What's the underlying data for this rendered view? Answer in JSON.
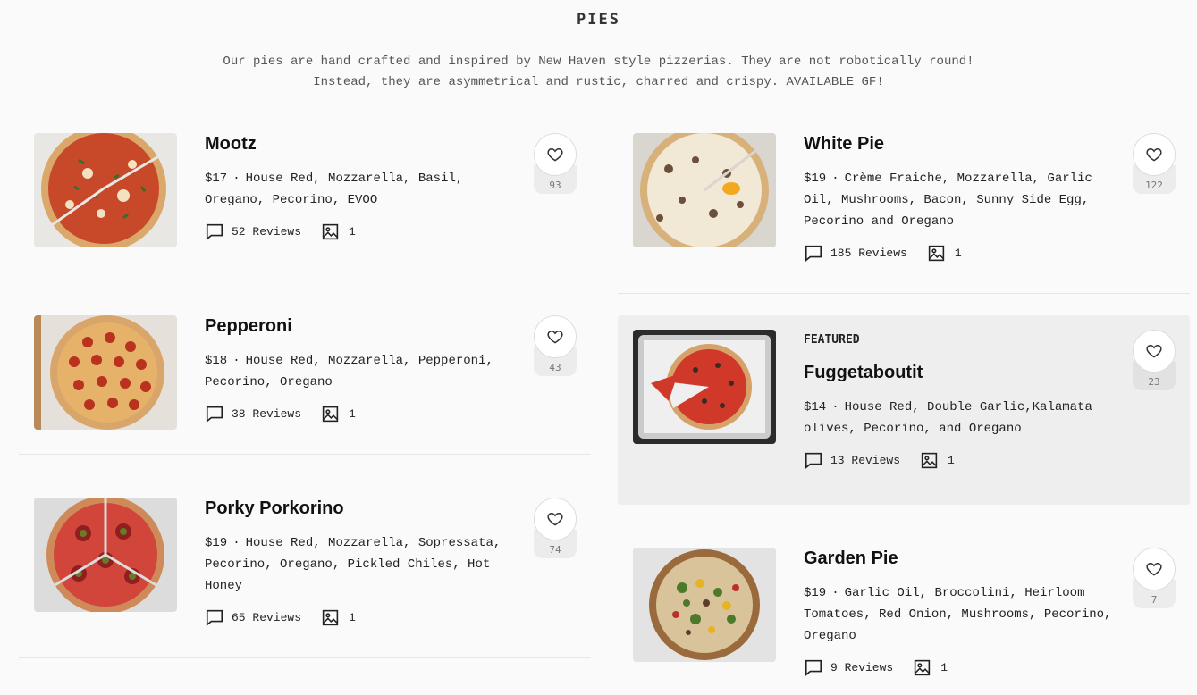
{
  "section": {
    "title": "PIES",
    "description_line1": "Our pies are hand crafted and inspired by New Haven style pizzerias. They are not robotically round!",
    "description_line2": "Instead, they are asymmetrical and rustic, charred and crispy. AVAILABLE GF!"
  },
  "left_items": [
    {
      "name": "Mootz",
      "price": "$17",
      "sep": "·",
      "ingredients": "House Red, Mozzarella, Basil, Oregano, Pecorino, EVOO",
      "reviews": "52 Reviews",
      "photos": "1",
      "likes": "93"
    },
    {
      "name": "Pepperoni",
      "price": "$18",
      "sep": "·",
      "ingredients": "House Red, Mozzarella, Pepperoni, Pecorino, Oregano",
      "reviews": "38 Reviews",
      "photos": "1",
      "likes": "43"
    },
    {
      "name": "Porky Porkorino",
      "price": "$19",
      "sep": "·",
      "ingredients": "House Red, Mozzarella, Sopressata, Pecorino, Oregano, Pickled Chiles, Hot Honey",
      "reviews": "65 Reviews",
      "photos": "1",
      "likes": "74"
    }
  ],
  "right_items": [
    {
      "name": "White Pie",
      "price": "$19",
      "sep": "·",
      "ingredients": "Crème Fraiche, Mozzarella, Garlic Oil, Mushrooms, Bacon, Sunny Side Egg, Pecorino and Oregano",
      "reviews": "185 Reviews",
      "photos": "1",
      "likes": "122"
    },
    {
      "featured_label": "FEATURED",
      "name": "Fuggetaboutit",
      "price": "$14",
      "sep": "·",
      "ingredients": "House Red, Double Garlic,Kalamata olives, Pecorino, and Oregano",
      "reviews": "13 Reviews",
      "photos": "1",
      "likes": "23"
    },
    {
      "name": "Garden Pie",
      "price": "$19",
      "sep": "·",
      "ingredients": "Garlic Oil, Broccolini, Heirloom Tomatoes, Red Onion, Mushrooms, Pecorino, Oregano",
      "reviews": "9 Reviews",
      "photos": "1",
      "likes": "7"
    }
  ],
  "icons": {
    "comment": "comment-icon",
    "photo": "image-icon",
    "heart": "heart-icon"
  }
}
